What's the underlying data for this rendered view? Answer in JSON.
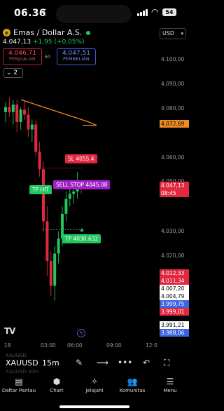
{
  "status_bar": {
    "time": "06.36",
    "battery": "54"
  },
  "header": {
    "title": "Emas / Dollar A.S.",
    "last_price": "4.047,13",
    "change": "+1,95 (+0,05%)",
    "currency": "USD",
    "sell_price": "4.046,71",
    "sell_label": "PENJUALAN",
    "spread": "60",
    "buy_price": "4.047,51",
    "buy_label": "PEMBELIAN",
    "layers_count": "2"
  },
  "price_axis": {
    "ticks": [
      "4.100,00",
      "4.090,00",
      "4.080,00",
      "4.060,00",
      "4.050,00",
      "4.030,00",
      "4.020,00"
    ],
    "tags": [
      {
        "text": "4.072,69",
        "color": "#f08a24",
        "text_color": "#000000"
      },
      {
        "text": "4.047,13",
        "color": "#e2283f",
        "text_color": "#ffffff"
      },
      {
        "text": "08:45",
        "color": "#e2283f",
        "text_color": "#ffffff"
      },
      {
        "text": "4.012,33",
        "color": "#e2283f",
        "text_color": "#ffffff"
      },
      {
        "text": "4.011,34",
        "color": "#e2283f",
        "text_color": "#ffffff"
      },
      {
        "text": "4.007,20",
        "color": "#ffffff",
        "text_color": "#000000"
      },
      {
        "text": "4.004,79",
        "color": "#ffffff",
        "text_color": "#000000"
      },
      {
        "text": "3.999,75",
        "color": "#3d63e0",
        "text_color": "#ffffff"
      },
      {
        "text": "3.999,01",
        "color": "#e2283f",
        "text_color": "#ffffff"
      },
      {
        "text": "3.991,21",
        "color": "#ffffff",
        "text_color": "#000000"
      },
      {
        "text": "3.988,06",
        "color": "#3d63e0",
        "text_color": "#ffffff"
      }
    ]
  },
  "orders": {
    "sl": "SL 4055.4",
    "sell_stop": "SELL STOP 4045.08",
    "tp_hit": "TP HIT",
    "tp": "TP 4030.632"
  },
  "time_axis": [
    "18",
    "03:00",
    "06:00",
    "09:00",
    "12:0"
  ],
  "toolbar": {
    "symbol": "XAUUSD",
    "timeframe": "15m",
    "ghost_text": "XAUUSD",
    "ghost_text_2": "XAUUSD 30m"
  },
  "bottom_nav": [
    {
      "label": "Daftar Pantau",
      "icon": "list-icon"
    },
    {
      "label": "Chart",
      "icon": "chart-icon"
    },
    {
      "label": "Jelajahi",
      "icon": "explore-icon"
    },
    {
      "label": "Komunitas",
      "icon": "community-icon"
    },
    {
      "label": "Menu",
      "icon": "menu-icon"
    }
  ],
  "colors": {
    "up": "#22c55e",
    "down": "#e2283f",
    "ma_line": "#f08a24",
    "sl_badge": "#e2283f",
    "sell_stop_badge": "#a020c8",
    "tp_badge": "#22c55e"
  },
  "chart_data": {
    "type": "candlestick",
    "price_lines": {
      "ma": 4072.69,
      "last": 4047.13,
      "sl": 4055.4,
      "sell_stop": 4045.08,
      "tp": 4030.632
    },
    "candles": [
      {
        "o": 4078,
        "h": 4082,
        "l": 4074,
        "c": 4080
      },
      {
        "o": 4080,
        "h": 4084,
        "l": 4076,
        "c": 4078
      },
      {
        "o": 4078,
        "h": 4083,
        "l": 4073,
        "c": 4081
      },
      {
        "o": 4081,
        "h": 4083,
        "l": 4070,
        "c": 4074
      },
      {
        "o": 4074,
        "h": 4080,
        "l": 4071,
        "c": 4079
      },
      {
        "o": 4079,
        "h": 4083,
        "l": 4075,
        "c": 4077
      },
      {
        "o": 4077,
        "h": 4080,
        "l": 4068,
        "c": 4071
      },
      {
        "o": 4071,
        "h": 4075,
        "l": 4066,
        "c": 4073
      },
      {
        "o": 4073,
        "h": 4075,
        "l": 4060,
        "c": 4062
      },
      {
        "o": 4062,
        "h": 4066,
        "l": 4052,
        "c": 4055
      },
      {
        "o": 4055,
        "h": 4058,
        "l": 4030,
        "c": 4034
      },
      {
        "o": 4034,
        "h": 4040,
        "l": 4012,
        "c": 4018
      },
      {
        "o": 4018,
        "h": 4022,
        "l": 4004,
        "c": 4008
      },
      {
        "o": 4008,
        "h": 4024,
        "l": 4002,
        "c": 4021
      },
      {
        "o": 4021,
        "h": 4030,
        "l": 4017,
        "c": 4027
      },
      {
        "o": 4027,
        "h": 4040,
        "l": 4024,
        "c": 4037
      },
      {
        "o": 4037,
        "h": 4046,
        "l": 4034,
        "c": 4043
      },
      {
        "o": 4043,
        "h": 4048,
        "l": 4040,
        "c": 4045
      },
      {
        "o": 4045,
        "h": 4049,
        "l": 4041,
        "c": 4046
      },
      {
        "o": 4046,
        "h": 4054,
        "l": 4043,
        "c": 4048
      },
      {
        "o": 4048,
        "h": 4050,
        "l": 4045,
        "c": 4047
      }
    ],
    "ma": [
      4083,
      4082.5,
      4082,
      4081.5,
      4081,
      4080.5,
      4080,
      4079.5,
      4079,
      4078.5,
      4078,
      4077.5,
      4077,
      4076.5,
      4076,
      4075.5,
      4075,
      4074.5,
      4074,
      4073.3,
      4072.69
    ]
  }
}
